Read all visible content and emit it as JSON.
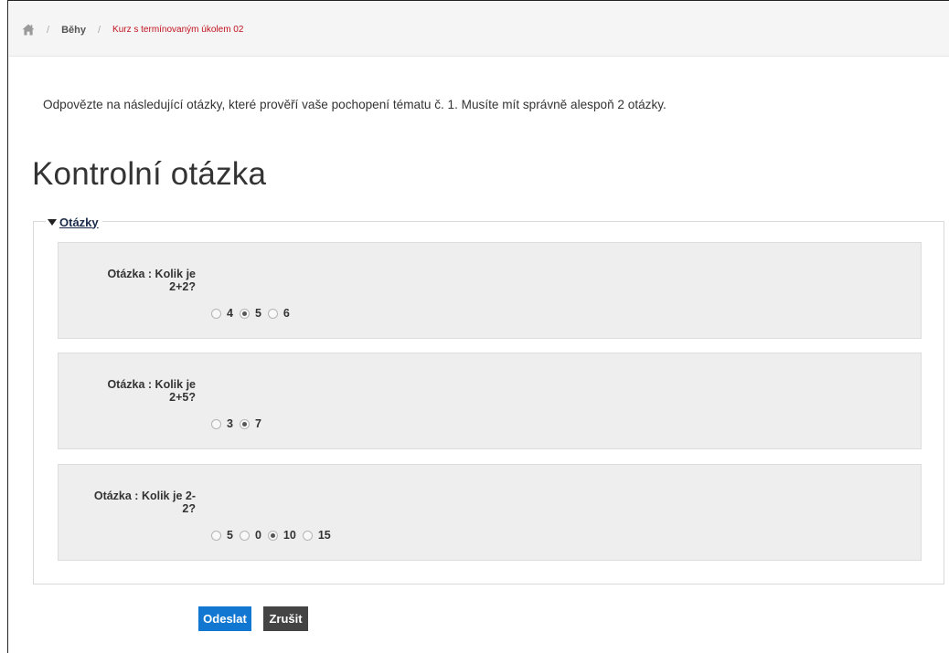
{
  "breadcrumb": {
    "home_icon": "home-icon",
    "separator": "/",
    "items": [
      {
        "label": "Běhy"
      },
      {
        "label": "Kurz s termínovaným úkolem 02"
      }
    ]
  },
  "intro": "Odpovězte na následující otázky, které prověří vaše pochopení tématu č. 1. Musíte mít správně alespoň 2 otázky.",
  "page_title": "Kontrolní otázka",
  "fieldset": {
    "legend": "Otázky",
    "collapse_icon": "triangle-down-icon"
  },
  "questions": [
    {
      "label_line1": "Otázka : Kolik je",
      "label_line2": "2+2?",
      "options": [
        {
          "label": "4",
          "checked": false
        },
        {
          "label": "5",
          "checked": true
        },
        {
          "label": "6",
          "checked": false
        }
      ]
    },
    {
      "label_line1": "Otázka : Kolik je",
      "label_line2": "2+5?",
      "options": [
        {
          "label": "3",
          "checked": false
        },
        {
          "label": "7",
          "checked": true
        }
      ]
    },
    {
      "label_line1": "Otázka : Kolik je 2-",
      "label_line2": "2?",
      "options": [
        {
          "label": "5",
          "checked": false
        },
        {
          "label": "0",
          "checked": false
        },
        {
          "label": "10",
          "checked": true
        },
        {
          "label": "15",
          "checked": false
        }
      ]
    }
  ],
  "buttons": {
    "submit": "Odeslat",
    "cancel": "Zrušit"
  },
  "colors": {
    "breadcrumb_current": "#c1121f",
    "primary_button": "#1177d1",
    "secondary_button": "#444444",
    "question_bg": "#eeeeee"
  }
}
